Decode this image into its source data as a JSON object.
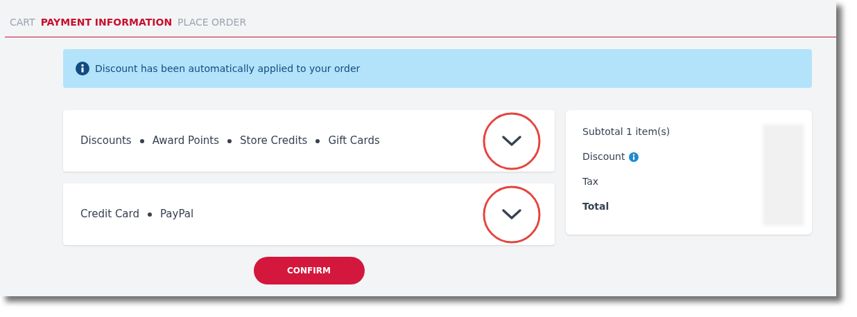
{
  "steps": [
    {
      "label": "CART",
      "selected": false
    },
    {
      "label": "PAYMENT INFORMATION",
      "selected": true
    },
    {
      "label": "PLACE ORDER",
      "selected": false
    }
  ],
  "alert": {
    "text": "Discount has been automatically applied to your order"
  },
  "sections": [
    {
      "options": [
        "Discounts",
        "Award Points",
        "Store Credits",
        "Gift Cards"
      ],
      "expanded": false
    },
    {
      "options": [
        "Credit Card",
        "PayPal"
      ],
      "expanded": false
    }
  ],
  "summary": {
    "rows": [
      {
        "label": "Subtotal 1 item(s)",
        "info": false,
        "bold": false
      },
      {
        "label": "Discount",
        "info": true,
        "bold": false
      },
      {
        "label": "Tax",
        "info": false,
        "bold": false
      },
      {
        "label": "Total",
        "info": false,
        "bold": true
      }
    ]
  },
  "confirm_button": "CONFIRM"
}
